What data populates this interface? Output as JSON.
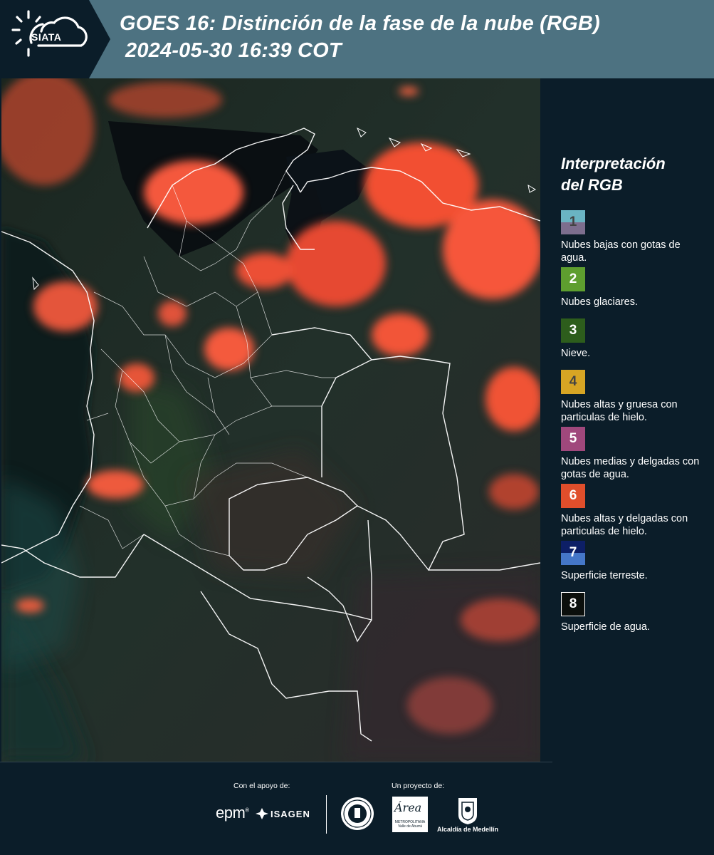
{
  "header": {
    "logo_text": "SIATA",
    "title_line1": "GOES 16: Distinción de la fase de la nube (RGB)",
    "title_line2": "2024-05-30 16:39 COT"
  },
  "legend": {
    "title_line1": "Interpretación",
    "title_line2": "del RGB",
    "items": [
      {
        "num": "1",
        "label": "Nubes bajas con gotas de agua.",
        "color_top": "#6ab4c3",
        "color_bottom": "#7d6e8e",
        "num_color": "#434343"
      },
      {
        "num": "2",
        "label": "Nubes glaciares.",
        "color": "#5e9e2f",
        "num_color": "#ffffff"
      },
      {
        "num": "3",
        "label": "Nieve.",
        "color": "#2d5d1c",
        "num_color": "#ffffff"
      },
      {
        "num": "4",
        "label": "Nubes altas y gruesa con particulas de hielo.",
        "color": "#d7a524",
        "num_color": "#434343"
      },
      {
        "num": "5",
        "label": "Nubes medias y delgadas con gotas de agua.",
        "color": "#a0487c",
        "num_color": "#ffffff"
      },
      {
        "num": "6",
        "label": "Nubes altas y delgadas con particulas de hielo.",
        "color": "#e04e2b",
        "num_color": "#ffffff"
      },
      {
        "num": "7",
        "label": "Superficie terreste.",
        "color_top": "#0d1f66",
        "color_bottom": "#4577c8",
        "num_color": "#ffffff"
      },
      {
        "num": "8",
        "label": "Superficie de agua.",
        "color": "#0b0f0c",
        "border": "#ffffff",
        "num_color": "#ffffff"
      }
    ]
  },
  "footer": {
    "support_label": "Con el apoyo de:",
    "project_label": "Un proyecto de:",
    "epm": "epm",
    "isagen": "ISAGEN",
    "area_script": "Área",
    "area_sub": "METROPOLITANA Valle de Aburrá",
    "medellin": "Alcaldía de Medellín"
  },
  "colors": {
    "background": "#0b1d29",
    "header_bar": "#4d7281",
    "cloud_ice": "#f2553a",
    "land": "#1d2a22",
    "water": "#0a0f12"
  }
}
